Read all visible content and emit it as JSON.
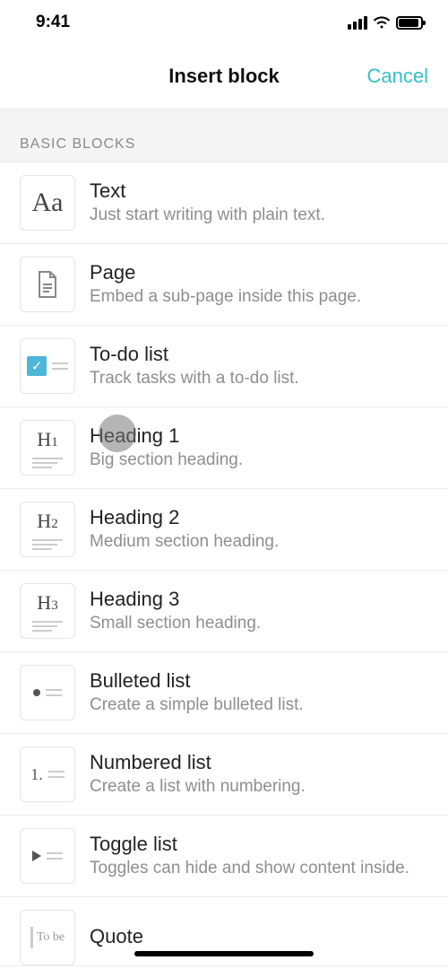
{
  "status": {
    "time": "9:41"
  },
  "modal": {
    "title": "Insert block",
    "cancel": "Cancel"
  },
  "section": {
    "basic": "BASIC BLOCKS"
  },
  "blocks": [
    {
      "icon": "Aa",
      "title": "Text",
      "desc": "Just start writing with plain text."
    },
    {
      "icon": "page",
      "title": "Page",
      "desc": "Embed a sub-page inside this page."
    },
    {
      "icon": "todo",
      "title": "To-do list",
      "desc": "Track tasks with a to-do list."
    },
    {
      "icon": "H1",
      "title": "Heading 1",
      "desc": "Big section heading."
    },
    {
      "icon": "H2",
      "title": "Heading 2",
      "desc": "Medium section heading."
    },
    {
      "icon": "H3",
      "title": "Heading 3",
      "desc": "Small section heading."
    },
    {
      "icon": "bul",
      "title": "Bulleted list",
      "desc": "Create a simple bulleted list."
    },
    {
      "icon": "num",
      "title": "Numbered list",
      "desc": "Create a list with numbering."
    },
    {
      "icon": "tog",
      "title": "Toggle list",
      "desc": "Toggles can hide and show content inside."
    },
    {
      "icon": "quote",
      "title": "Quote",
      "desc": ""
    }
  ]
}
